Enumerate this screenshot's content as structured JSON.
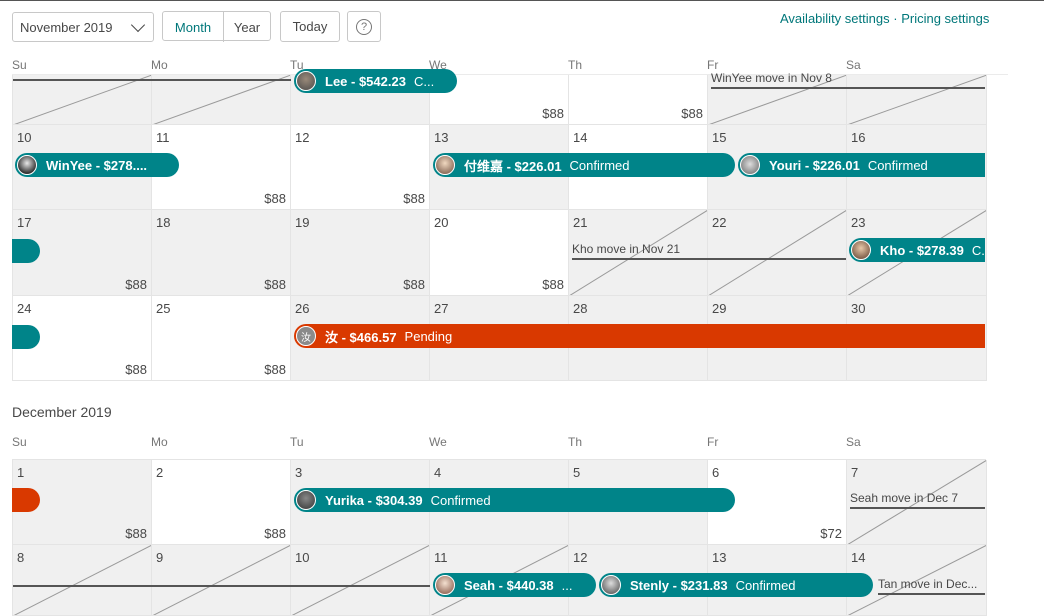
{
  "header": {
    "month_select": "November 2019",
    "view_month": "Month",
    "view_year": "Year",
    "today": "Today",
    "help": "?",
    "availability_link": "Availability settings",
    "separator": "·",
    "pricing_link": "Pricing settings"
  },
  "weekdays": [
    "Su",
    "Mo",
    "Tu",
    "We",
    "Th",
    "Fr",
    "Sa"
  ],
  "colors": {
    "accent": "#008489",
    "pending": "#d93900",
    "link": "#00777a"
  },
  "november": {
    "days": [
      {
        "n": "",
        "price": ""
      },
      {
        "n": "",
        "price": ""
      },
      {
        "n": "",
        "price": ""
      },
      {
        "n": "",
        "price": "$88"
      },
      {
        "n": "",
        "price": "$88"
      },
      {
        "n": "",
        "price": ""
      },
      {
        "n": "",
        "price": ""
      },
      {
        "n": "10",
        "price": ""
      },
      {
        "n": "11",
        "price": "$88"
      },
      {
        "n": "12",
        "price": "$88"
      },
      {
        "n": "13",
        "price": ""
      },
      {
        "n": "14",
        "price": ""
      },
      {
        "n": "15",
        "price": ""
      },
      {
        "n": "16",
        "price": ""
      },
      {
        "n": "17",
        "price": "$88"
      },
      {
        "n": "18",
        "price": "$88"
      },
      {
        "n": "19",
        "price": "$88"
      },
      {
        "n": "20",
        "price": "$88"
      },
      {
        "n": "21",
        "price": ""
      },
      {
        "n": "22",
        "price": ""
      },
      {
        "n": "23",
        "price": ""
      },
      {
        "n": "24",
        "price": "$88"
      },
      {
        "n": "25",
        "price": "$88"
      },
      {
        "n": "26",
        "price": ""
      },
      {
        "n": "27",
        "price": ""
      },
      {
        "n": "28",
        "price": ""
      },
      {
        "n": "29",
        "price": ""
      },
      {
        "n": "30",
        "price": ""
      }
    ],
    "bookings": [
      {
        "guest": "Lee - $542.23",
        "status": "C..."
      },
      {
        "guest": "WinYee - $278....",
        "status": ""
      },
      {
        "guest": "付维嘉 - $226.01",
        "status": "Confirmed"
      },
      {
        "guest": "Youri - $226.01",
        "status": "Confirmed"
      },
      {
        "guest": "Kho - $278.39",
        "status": "C..."
      },
      {
        "guest": "汝 - $466.57",
        "status": "Pending"
      }
    ],
    "avatar_glyph": "汝",
    "move_notes": [
      "WinYee move in Nov 8",
      "Kho move in Nov 21"
    ]
  },
  "december": {
    "title": "December 2019",
    "days": [
      {
        "n": "1",
        "price": "$88"
      },
      {
        "n": "2",
        "price": "$88"
      },
      {
        "n": "3",
        "price": ""
      },
      {
        "n": "4",
        "price": ""
      },
      {
        "n": "5",
        "price": ""
      },
      {
        "n": "6",
        "price": "$72"
      },
      {
        "n": "7",
        "price": ""
      },
      {
        "n": "8",
        "price": ""
      },
      {
        "n": "9",
        "price": ""
      },
      {
        "n": "10",
        "price": ""
      },
      {
        "n": "11",
        "price": ""
      },
      {
        "n": "12",
        "price": ""
      },
      {
        "n": "13",
        "price": ""
      },
      {
        "n": "14",
        "price": ""
      }
    ],
    "bookings": [
      {
        "guest": "Yurika - $304.39",
        "status": "Confirmed"
      },
      {
        "guest": "Seah - $440.38",
        "status": "..."
      },
      {
        "guest": "Stenly - $231.83",
        "status": "Confirmed"
      }
    ],
    "move_notes": [
      "Seah move in Dec 7",
      "Tan move in Dec..."
    ]
  }
}
